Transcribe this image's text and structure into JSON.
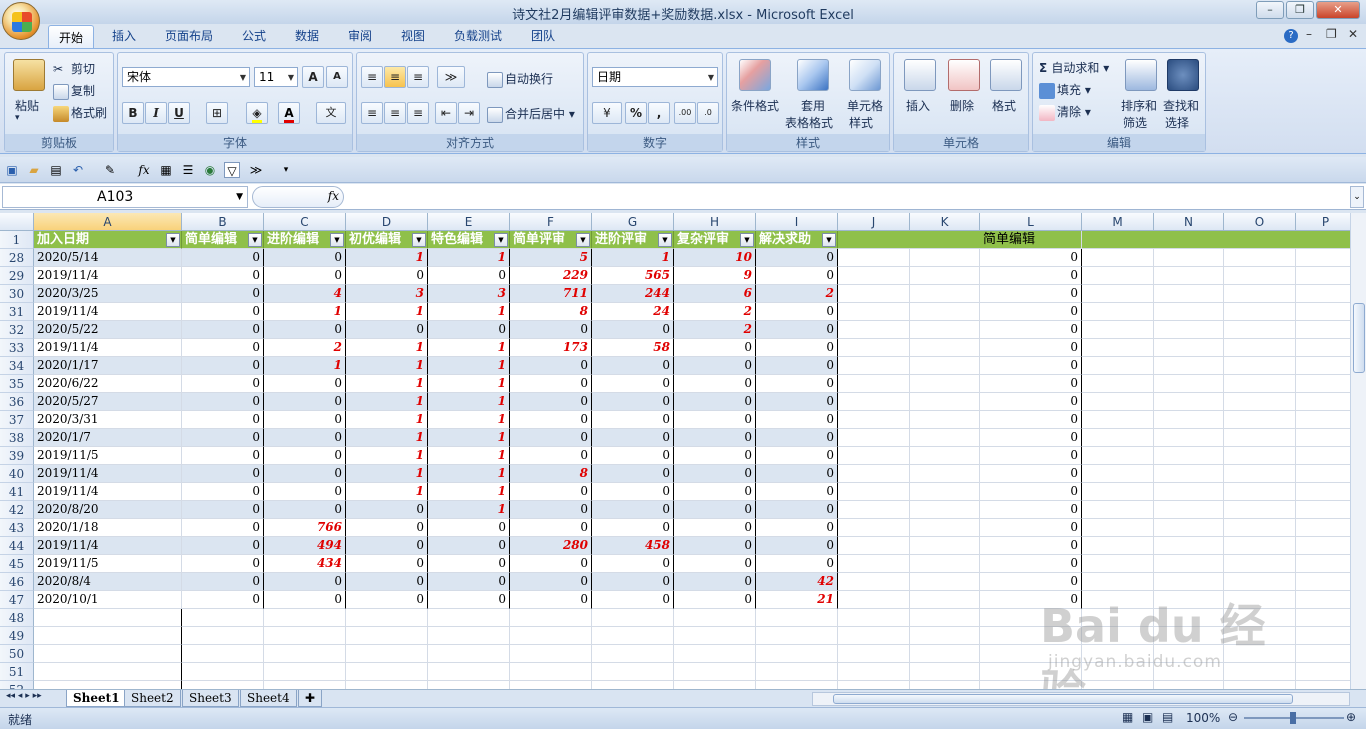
{
  "window": {
    "title": "诗文社2月编辑评审数据+奖励数据.xlsx - Microsoft Excel"
  },
  "ribbon_tabs": [
    "开始",
    "插入",
    "页面布局",
    "公式",
    "数据",
    "审阅",
    "视图",
    "负载测试",
    "团队"
  ],
  "clipboard": {
    "paste": "粘贴",
    "cut": "剪切",
    "copy": "复制",
    "format_painter": "格式刷",
    "group": "剪贴板"
  },
  "font": {
    "name": "宋体",
    "size": "11",
    "group": "字体",
    "bold": "B",
    "italic": "I",
    "underline": "U",
    "grow": "A",
    "shrink": "A"
  },
  "alignment": {
    "wrap": "自动换行",
    "merge": "合并后居中",
    "group": "对齐方式"
  },
  "number": {
    "format": "日期",
    "percent": "%",
    "comma": ",",
    "group": "数字"
  },
  "styles": {
    "conditional": "条件格式",
    "table_format_1": "套用",
    "table_format_2": "表格格式",
    "cell_style_1": "单元格",
    "cell_style_2": "样式",
    "group": "样式"
  },
  "cells": {
    "insert": "插入",
    "delete": "删除",
    "format": "格式",
    "group": "单元格"
  },
  "editing": {
    "autosum": "自动求和",
    "fill": "填充",
    "clear": "清除",
    "sort_1": "排序和",
    "sort_2": "筛选",
    "find_1": "查找和",
    "find_2": "选择",
    "group": "编辑"
  },
  "formula_bar": {
    "name_box": "A103",
    "fx": "fx",
    "formula": ""
  },
  "columns": [
    "A",
    "B",
    "C",
    "D",
    "E",
    "F",
    "G",
    "H",
    "I",
    "J",
    "K",
    "L",
    "M",
    "N",
    "O",
    "P"
  ],
  "header_row": {
    "row": "1",
    "cells": [
      "加入日期",
      "简单编辑",
      "进阶编辑",
      "初优编辑",
      "特色编辑",
      "简单评审",
      "进阶评审",
      "复杂评审",
      "解决求助"
    ],
    "L": "简单编辑"
  },
  "rows": [
    {
      "r": "28",
      "a": "2020/5/14",
      "v": [
        "0",
        "0",
        "1",
        "1",
        "5",
        "1",
        "10",
        "0"
      ],
      "l": "0"
    },
    {
      "r": "29",
      "a": "2019/11/4",
      "v": [
        "0",
        "0",
        "0",
        "0",
        "229",
        "565",
        "9",
        "0"
      ],
      "l": "0"
    },
    {
      "r": "30",
      "a": "2020/3/25",
      "v": [
        "0",
        "4",
        "3",
        "3",
        "711",
        "244",
        "6",
        "2"
      ],
      "l": "0"
    },
    {
      "r": "31",
      "a": "2019/11/4",
      "v": [
        "0",
        "1",
        "1",
        "1",
        "8",
        "24",
        "2",
        "0"
      ],
      "l": "0"
    },
    {
      "r": "32",
      "a": "2020/5/22",
      "v": [
        "0",
        "0",
        "0",
        "0",
        "0",
        "0",
        "2",
        "0"
      ],
      "l": "0"
    },
    {
      "r": "33",
      "a": "2019/11/4",
      "v": [
        "0",
        "2",
        "1",
        "1",
        "173",
        "58",
        "0",
        "0"
      ],
      "l": "0"
    },
    {
      "r": "34",
      "a": "2020/1/17",
      "v": [
        "0",
        "1",
        "1",
        "1",
        "0",
        "0",
        "0",
        "0"
      ],
      "l": "0"
    },
    {
      "r": "35",
      "a": "2020/6/22",
      "v": [
        "0",
        "0",
        "1",
        "1",
        "0",
        "0",
        "0",
        "0"
      ],
      "l": "0"
    },
    {
      "r": "36",
      "a": "2020/5/27",
      "v": [
        "0",
        "0",
        "1",
        "1",
        "0",
        "0",
        "0",
        "0"
      ],
      "l": "0"
    },
    {
      "r": "37",
      "a": "2020/3/31",
      "v": [
        "0",
        "0",
        "1",
        "1",
        "0",
        "0",
        "0",
        "0"
      ],
      "l": "0"
    },
    {
      "r": "38",
      "a": "2020/1/7",
      "v": [
        "0",
        "0",
        "1",
        "1",
        "0",
        "0",
        "0",
        "0"
      ],
      "l": "0"
    },
    {
      "r": "39",
      "a": "2019/11/5",
      "v": [
        "0",
        "0",
        "1",
        "1",
        "0",
        "0",
        "0",
        "0"
      ],
      "l": "0"
    },
    {
      "r": "40",
      "a": "2019/11/4",
      "v": [
        "0",
        "0",
        "1",
        "1",
        "8",
        "0",
        "0",
        "0"
      ],
      "l": "0"
    },
    {
      "r": "41",
      "a": "2019/11/4",
      "v": [
        "0",
        "0",
        "1",
        "1",
        "0",
        "0",
        "0",
        "0"
      ],
      "l": "0"
    },
    {
      "r": "42",
      "a": "2020/8/20",
      "v": [
        "0",
        "0",
        "0",
        "1",
        "0",
        "0",
        "0",
        "0"
      ],
      "l": "0"
    },
    {
      "r": "43",
      "a": "2020/1/18",
      "v": [
        "0",
        "766",
        "0",
        "0",
        "0",
        "0",
        "0",
        "0"
      ],
      "l": "0"
    },
    {
      "r": "44",
      "a": "2019/11/4",
      "v": [
        "0",
        "494",
        "0",
        "0",
        "280",
        "458",
        "0",
        "0"
      ],
      "l": "0"
    },
    {
      "r": "45",
      "a": "2019/11/5",
      "v": [
        "0",
        "434",
        "0",
        "0",
        "0",
        "0",
        "0",
        "0"
      ],
      "l": "0"
    },
    {
      "r": "46",
      "a": "2020/8/4",
      "v": [
        "0",
        "0",
        "0",
        "0",
        "0",
        "0",
        "0",
        "42"
      ],
      "l": "0"
    },
    {
      "r": "47",
      "a": "2020/10/1",
      "v": [
        "0",
        "0",
        "0",
        "0",
        "0",
        "0",
        "0",
        "21"
      ],
      "l": "0"
    }
  ],
  "empty_rows": [
    "48",
    "49",
    "50",
    "51",
    "52"
  ],
  "sheets": [
    "Sheet1",
    "Sheet2",
    "Sheet3",
    "Sheet4"
  ],
  "status": {
    "ready": "就绪",
    "zoom": "100%"
  },
  "watermark": {
    "main": "Bai du 经验",
    "sub": "jingyan.baidu.com"
  }
}
